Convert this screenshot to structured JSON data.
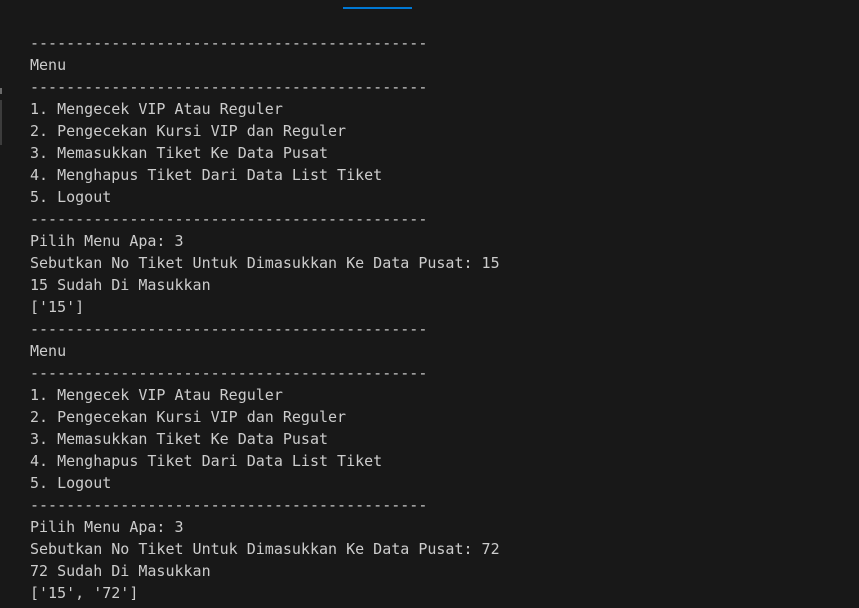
{
  "terminal": {
    "lines": [
      "--------------------------------------------",
      "Menu",
      "--------------------------------------------",
      "1. Mengecek VIP Atau Reguler",
      "2. Pengecekan Kursi VIP dan Reguler",
      "3. Memasukkan Tiket Ke Data Pusat",
      "4. Menghapus Tiket Dari Data List Tiket",
      "5. Logout",
      "--------------------------------------------",
      "Pilih Menu Apa: 3",
      "Sebutkan No Tiket Untuk Dimasukkan Ke Data Pusat: 15",
      "15 Sudah Di Masukkan",
      "['15']",
      "--------------------------------------------",
      "Menu",
      "--------------------------------------------",
      "1. Mengecek VIP Atau Reguler",
      "2. Pengecekan Kursi VIP dan Reguler",
      "3. Memasukkan Tiket Ke Data Pusat",
      "4. Menghapus Tiket Dari Data List Tiket",
      "5. Logout",
      "--------------------------------------------",
      "Pilih Menu Apa: 3",
      "Sebutkan No Tiket Untuk Dimasukkan Ke Data Pusat: 72",
      "72 Sudah Di Masukkan",
      "['15', '72']"
    ]
  },
  "colors": {
    "background": "#181818",
    "text": "#cccccc",
    "accent": "#0078d4"
  }
}
